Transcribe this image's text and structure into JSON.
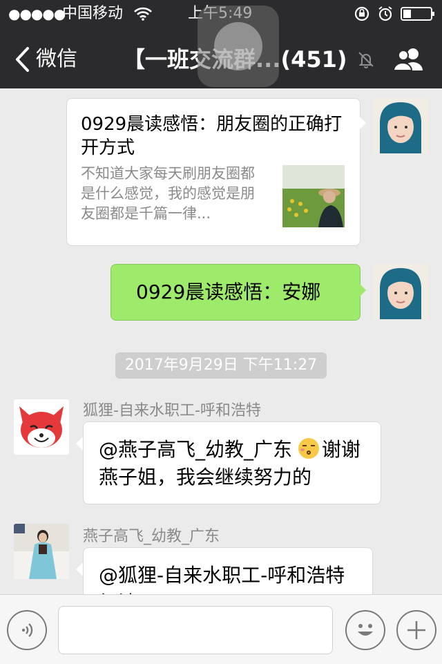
{
  "status_bar": {
    "signal_dots": "●●●●●",
    "carrier": "中国移动",
    "time": "上午5:49",
    "icons": [
      "signal-icon",
      "wifi-icon",
      "rotation-lock-icon",
      "alarm-icon",
      "battery-icon"
    ]
  },
  "nav": {
    "back_label": "微信",
    "title": "【一班交流群...(451)",
    "icons": [
      "back-arrow-icon",
      "mute-bell-icon",
      "group-members-icon"
    ]
  },
  "messages": {
    "article": {
      "title": "0929晨读感悟：朋友圈的正确打开方式",
      "summary": "不知道大家每天刷朋友圈都是什么感觉，我的感觉是朋友圈都是千篇一律..."
    },
    "green": {
      "text": "0929晨读感悟：安娜"
    },
    "timestamp": "2017年9月29日 下午11:27",
    "fox": {
      "sender": "狐狸-自来水职工-呼和浩特",
      "text_before_emoji": "@燕子高飞_幼教_广东 ",
      "text_after_emoji": "谢谢燕子姐，我会继续努力的"
    },
    "yanzi": {
      "sender": "燕子高飞_幼教_广东",
      "text": "@狐狸-自来水职工-呼和浩特加油了"
    }
  },
  "input_bar": {
    "icons": [
      "voice-icon",
      "emoji-icon",
      "plus-icon"
    ],
    "input_value": ""
  },
  "colors": {
    "nav_bg": "#2b2b2e",
    "chat_bg": "#ebebeb",
    "green_bubble": "#9eea6a",
    "white_bubble": "#ffffff"
  }
}
